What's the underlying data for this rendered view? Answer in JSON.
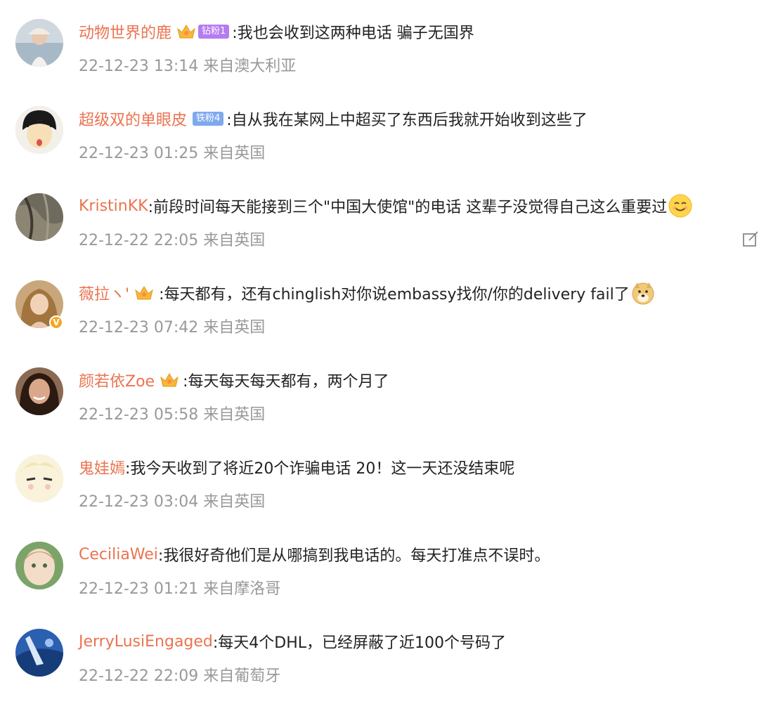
{
  "comments": [
    {
      "user": "动物世界的鹿",
      "badge": "钻粉1",
      "text": ":我也会收到这两种电话 骗子无国界",
      "time": "22-12-23 13:14",
      "location": "来自澳大利亚"
    },
    {
      "user": "超级双的单眼皮",
      "badge": "铁粉4",
      "text": ":自从我在某网上中超买了东西后我就开始收到这些了",
      "time": "22-12-23 01:25",
      "location": "来自英国"
    },
    {
      "user": "KristinKK",
      "text": ":前段时间每天能接到三个\"中国大使馆\"的电话 这辈子没觉得自己这么重要过",
      "time": "22-12-22 22:05",
      "location": "来自英国"
    },
    {
      "user": "薇拉ヽ'",
      "text": ":每天都有，还有chinglish对你说embassy找你/你的delivery fail了",
      "time": "22-12-23 07:42",
      "location": "来自英国"
    },
    {
      "user": "颜若依Zoe",
      "text": ":每天每天每天都有，两个月了",
      "time": "22-12-23 05:58",
      "location": "来自英国"
    },
    {
      "user": "鬼娃嫣",
      "text": ":我今天收到了将近20个诈骗电话 20！这一天还没结束呢",
      "time": "22-12-23 03:04",
      "location": "来自英国"
    },
    {
      "user": "CeciliaWei",
      "text": ":我很好奇他们是从哪搞到我电话的。每天打准点不误时。",
      "time": "22-12-23 01:21",
      "location": "来自摩洛哥"
    },
    {
      "user": "JerryLusiEngaged",
      "text": ":每天4个DHL，已经屏蔽了近100个号码了",
      "time": "22-12-22 22:09",
      "location": "来自葡萄牙"
    }
  ],
  "verified_mark": "V",
  "colors": {
    "username": "#eb7350",
    "text": "#222222",
    "meta": "#999999"
  }
}
